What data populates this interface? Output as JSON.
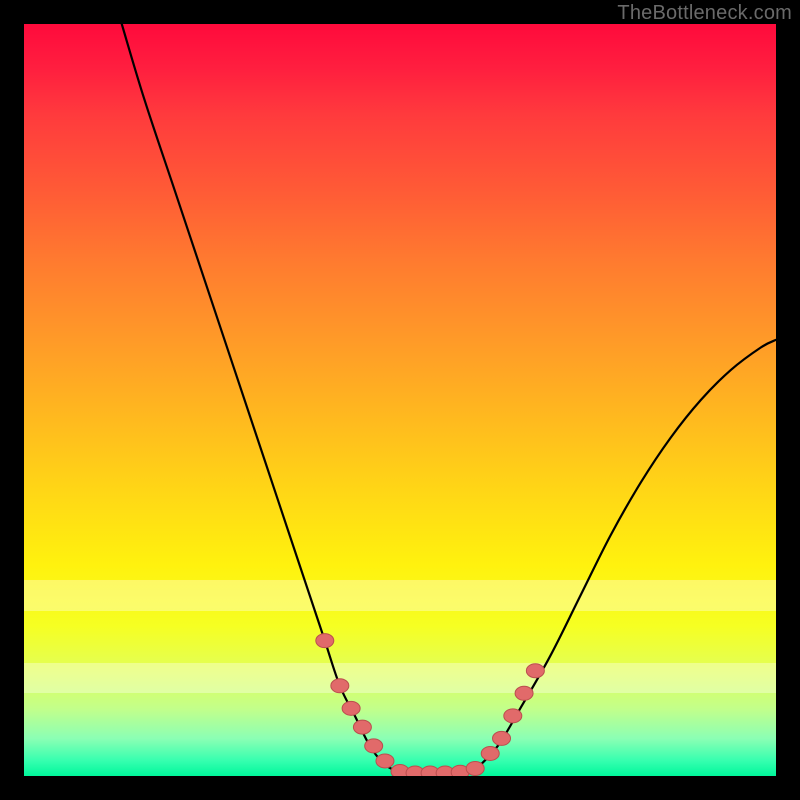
{
  "watermark": "TheBottleneck.com",
  "colors": {
    "frame": "#000000",
    "curve": "#000000",
    "marker_fill": "#e16a6a",
    "marker_stroke": "#bb4e4e",
    "gradient_top": "#ff0a3c",
    "gradient_bottom": "#00f79b"
  },
  "chart_data": {
    "type": "line",
    "title": "",
    "xlabel": "",
    "ylabel": "",
    "xlim": [
      0,
      100
    ],
    "ylim": [
      0,
      100
    ],
    "series": [
      {
        "name": "left-branch",
        "x": [
          13,
          16,
          20,
          24,
          28,
          32,
          35,
          38,
          40,
          42,
          44,
          46,
          48,
          50
        ],
        "y": [
          100,
          90,
          78,
          66,
          54,
          42,
          33,
          24,
          18,
          12,
          8,
          4,
          1.5,
          0.5
        ]
      },
      {
        "name": "valley-floor",
        "x": [
          50,
          52,
          54,
          56,
          58,
          60
        ],
        "y": [
          0.5,
          0.3,
          0.3,
          0.3,
          0.4,
          0.8
        ]
      },
      {
        "name": "right-branch",
        "x": [
          60,
          63,
          66,
          70,
          74,
          78,
          82,
          86,
          90,
          94,
          98,
          100
        ],
        "y": [
          0.8,
          4,
          9,
          16,
          24,
          32,
          39,
          45,
          50,
          54,
          57,
          58
        ]
      }
    ],
    "markers": {
      "name": "highlight-points",
      "x": [
        40,
        42,
        43.5,
        45,
        46.5,
        48,
        50,
        52,
        54,
        56,
        58,
        60,
        62,
        63.5,
        65,
        66.5,
        68
      ],
      "y": [
        18,
        12,
        9,
        6.5,
        4,
        2,
        0.6,
        0.4,
        0.4,
        0.4,
        0.5,
        1,
        3,
        5,
        8,
        11,
        14
      ]
    },
    "bands": [
      {
        "name": "pale-band-1",
        "y0": 22,
        "y1": 26
      },
      {
        "name": "pale-band-2",
        "y0": 11,
        "y1": 15
      }
    ]
  }
}
